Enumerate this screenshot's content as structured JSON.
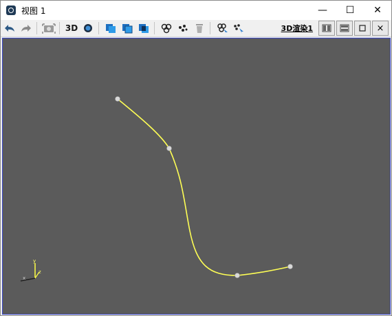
{
  "window": {
    "title": "视图 1",
    "minimize_glyph": "—",
    "maximize_glyph": "☐",
    "close_glyph": "✕"
  },
  "toolbar": {
    "btn_3d": "3D",
    "render_link": "3D渲染1",
    "icons": [
      "undo-icon",
      "redo-icon",
      "camera-fit-icon",
      "3d-view-toggle",
      "sphere-icon",
      "boolean-union-icon",
      "boolean-subtract-icon",
      "boolean-intersect-icon",
      "three-circles-icon",
      "scatter-points-icon",
      "trash-icon",
      "select-circles-icon",
      "select-points-icon",
      "split-vertical-icon",
      "split-horizontal-icon",
      "restore-panel-icon",
      "close-panel-icon"
    ],
    "close_panel_glyph": "×"
  },
  "viewport": {
    "background": "#5b5b5b",
    "curve_color": "#ffff55",
    "control_point_color": "#d8d8d8",
    "axis_labels": {
      "z": "z",
      "y": "y",
      "x": "x"
    }
  }
}
